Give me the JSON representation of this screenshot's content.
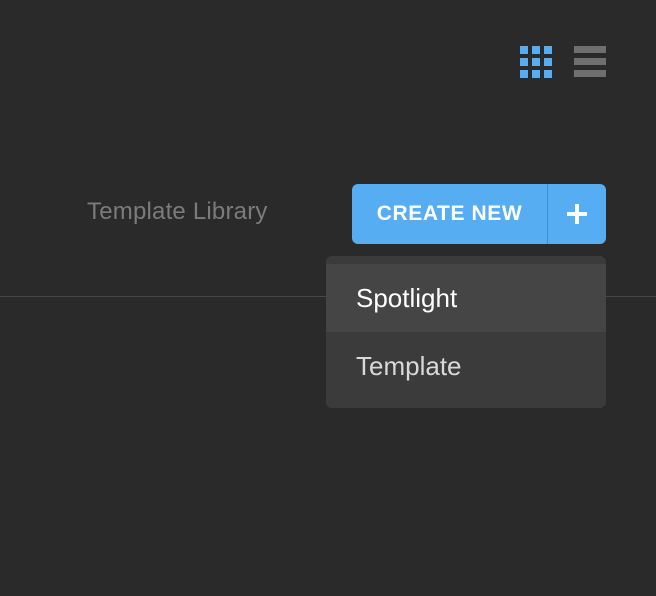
{
  "toolbar": {
    "grid_view_icon": "grid-icon",
    "list_view_icon": "list-icon",
    "grid_active_color": "#56adf1",
    "list_color": "#6f6f6f"
  },
  "header": {
    "library_link": "Template Library",
    "create_button_label": "CREATE NEW",
    "create_button_icon": "plus-icon",
    "accent_color": "#56adf1"
  },
  "dropdown": {
    "items": [
      {
        "label": "Spotlight",
        "highlighted": true
      },
      {
        "label": "Template",
        "highlighted": false
      }
    ]
  }
}
